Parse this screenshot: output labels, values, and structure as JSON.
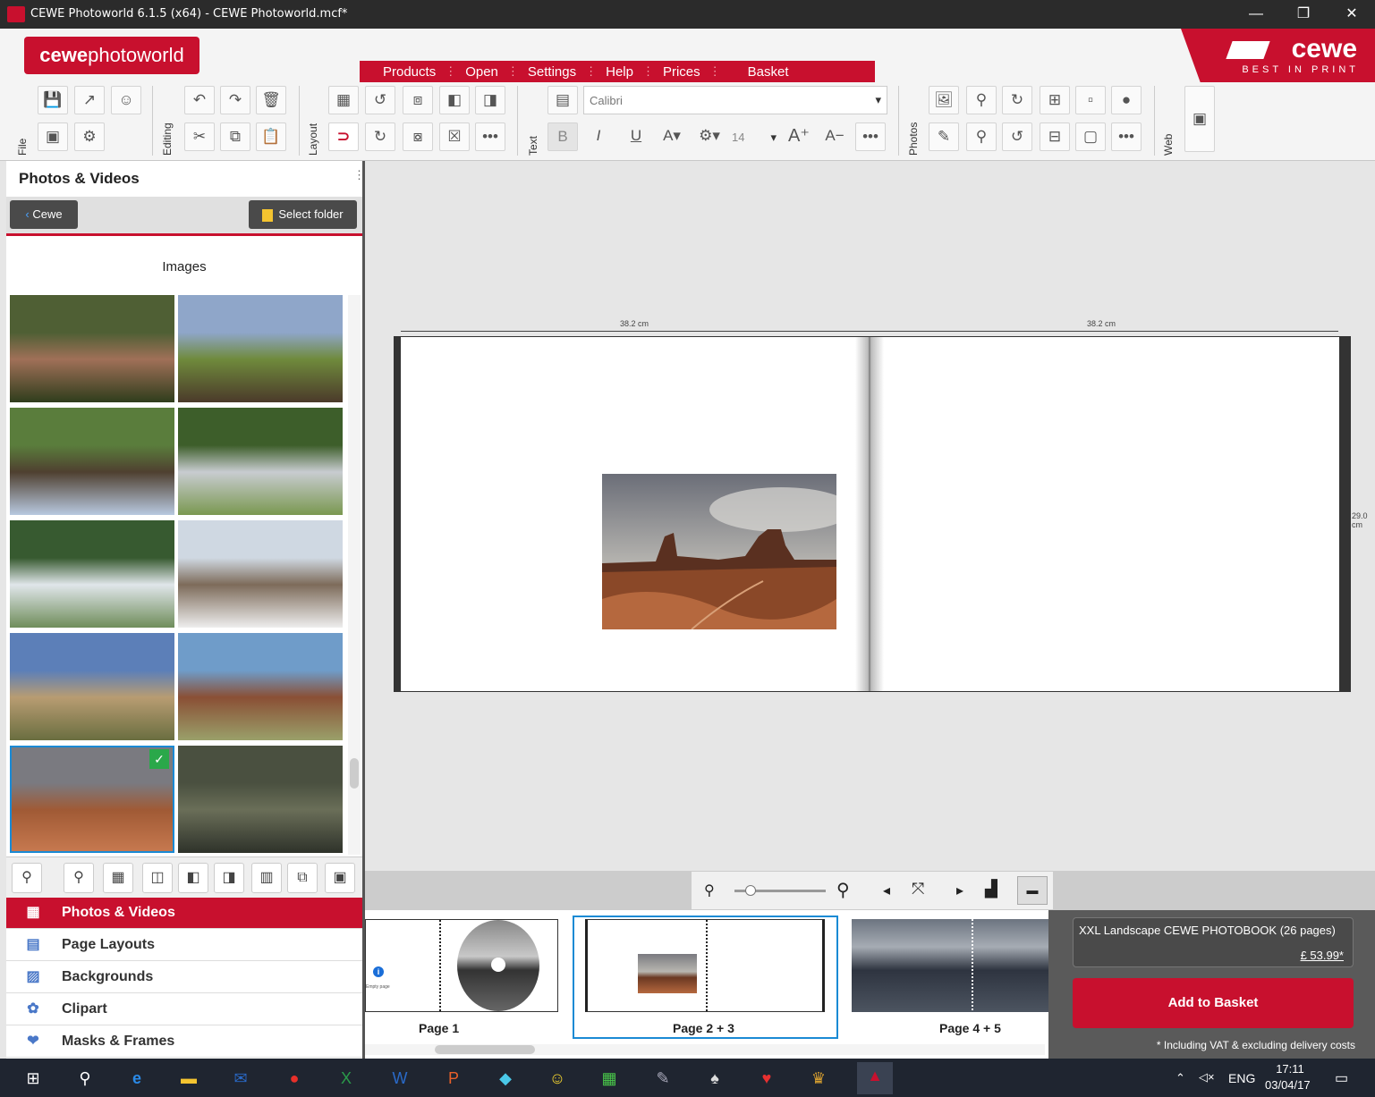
{
  "window": {
    "title": "CEWE Photoworld 6.1.5 (x64) - CEWE Photoworld.mcf*",
    "min": "—",
    "restore": "❐",
    "close": "✕"
  },
  "logo": {
    "bold": "cewe",
    "rest": "photoworld"
  },
  "brand": {
    "word": "cewe",
    "tagline": "BEST IN PRINT"
  },
  "menu": {
    "items": [
      "Products",
      "Open",
      "Settings",
      "Help",
      "Prices",
      "Basket"
    ]
  },
  "toolbar": {
    "groups": {
      "file": "File",
      "editing": "Editing",
      "layout": "Layout",
      "text": "Text",
      "photos": "Photos",
      "web": "Web"
    },
    "font": "Calibri",
    "font_size": "14",
    "bold": "B",
    "italic": "I",
    "underline": "U",
    "grow": "A⁺",
    "shrink": "A−",
    "more": "•••"
  },
  "sidebar": {
    "title": "Photos & Videos",
    "back_label": "Cewe",
    "select_folder": "Select folder",
    "images_label": "Images",
    "thumbnails": [
      {
        "name": "garden-courtyard",
        "colors": [
          "#4f5f34",
          "#a07058",
          "#2f3d1c"
        ]
      },
      {
        "name": "log-cabin",
        "colors": [
          "#8fa6c9",
          "#6f8a3c",
          "#4b3a2a"
        ]
      },
      {
        "name": "water-mill",
        "colors": [
          "#5a7d3c",
          "#4f4030",
          "#b8c9e0"
        ]
      },
      {
        "name": "forest-bridge",
        "colors": [
          "#3d5e2a",
          "#c8ccd0",
          "#7a9850"
        ]
      },
      {
        "name": "waterfall",
        "colors": [
          "#375a30",
          "#e0e6ea",
          "#6f8d5a"
        ]
      },
      {
        "name": "gateway-arch",
        "colors": [
          "#cfd8e2",
          "#7d6b5a",
          "#eeeeee"
        ]
      },
      {
        "name": "canyon-cliff",
        "colors": [
          "#5c7fb8",
          "#b89c72",
          "#6a6e40"
        ]
      },
      {
        "name": "petrified-log",
        "colors": [
          "#6f9cc9",
          "#8a4f35",
          "#9aa06a"
        ]
      },
      {
        "name": "monument-valley",
        "colors": [
          "#7a7a80",
          "#a05a35",
          "#c87a50"
        ],
        "selected": true
      },
      {
        "name": "dark-canyon",
        "colors": [
          "#4a5040",
          "#6a6e58",
          "#2e322a"
        ]
      },
      {
        "name": "blue-sky",
        "colors": [
          "#4a78c8",
          "#ffffff"
        ]
      },
      {
        "name": "blue-sky-2",
        "colors": [
          "#5a88d0",
          "#c0d0e8"
        ]
      }
    ],
    "nav": [
      {
        "label": "Photos & Videos",
        "icon": "▦",
        "active": true
      },
      {
        "label": "Page Layouts",
        "icon": "▤"
      },
      {
        "label": "Backgrounds",
        "icon": "▨"
      },
      {
        "label": "Clipart",
        "icon": "✿"
      },
      {
        "label": "Masks & Frames",
        "icon": "❤"
      }
    ]
  },
  "canvas": {
    "ruler_left": "38.2 cm",
    "ruler_right": "38.2 cm",
    "ruler_height": "29.0 cm"
  },
  "pages": [
    {
      "label": "Page 1",
      "empty_text": "Empty page"
    },
    {
      "label": "Page 2 + 3"
    },
    {
      "label": "Page 4 + 5"
    }
  ],
  "price": {
    "product": "XXL Landscape CEWE PHOTOBOOK (26 pages)",
    "amount": "£ 53.99*",
    "add_button": "Add to Basket",
    "vat_note": "* Including VAT & excluding delivery costs"
  },
  "taskbar": {
    "lang": "ENG",
    "time": "17:11",
    "date": "03/04/17"
  }
}
